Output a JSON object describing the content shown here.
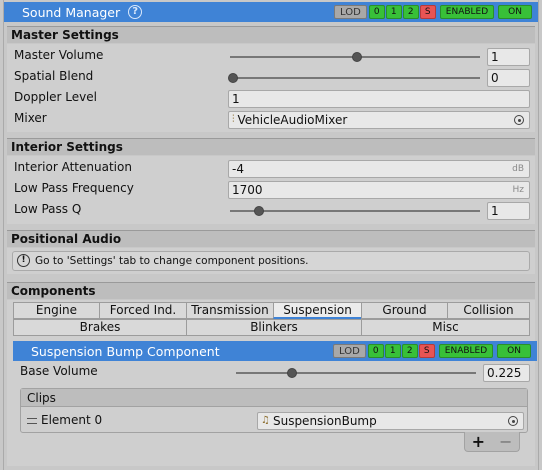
{
  "header": {
    "title": "Sound Manager",
    "badges": {
      "lod": "LOD",
      "levels": [
        "0",
        "1",
        "2",
        "S"
      ],
      "enabled": "ENABLED",
      "on": "ON"
    }
  },
  "master_settings": {
    "title": "Master Settings",
    "master_volume": {
      "label": "Master Volume",
      "value": "1",
      "slider": 0.55
    },
    "spatial_blend": {
      "label": "Spatial Blend",
      "value": "0",
      "slider": 0.0
    },
    "doppler_level": {
      "label": "Doppler Level",
      "value": "1"
    },
    "mixer": {
      "label": "Mixer",
      "value": "VehicleAudioMixer"
    }
  },
  "interior_settings": {
    "title": "Interior Settings",
    "attenuation": {
      "label": "Interior Attenuation",
      "value": "-4",
      "unit": "dB"
    },
    "low_pass_frequency": {
      "label": "Low Pass Frequency",
      "value": "1700",
      "unit": "Hz"
    },
    "low_pass_q": {
      "label": "Low Pass Q",
      "value": "1",
      "slider": 0.12
    }
  },
  "positional_audio": {
    "title": "Positional Audio",
    "help": "Go to 'Settings' tab to change component positions."
  },
  "components": {
    "title": "Components",
    "tabs_row1": [
      "Engine",
      "Forced Ind.",
      "Transmission",
      "Suspension",
      "Ground",
      "Collision"
    ],
    "tabs_row2": [
      "Brakes",
      "Blinkers",
      "Misc"
    ],
    "active_tab": "Suspension"
  },
  "suspension_component": {
    "title": "Suspension Bump Component",
    "badges": {
      "lod": "LOD",
      "levels": [
        "0",
        "1",
        "2",
        "S"
      ],
      "enabled": "ENABLED",
      "on": "ON"
    },
    "base_volume": {
      "label": "Base Volume",
      "value": "0.225",
      "slider": 0.23
    },
    "clips": {
      "title": "Clips",
      "elements": [
        {
          "label": "Element 0",
          "value": "SuspensionBump"
        }
      ],
      "add": "+",
      "remove": "−"
    }
  },
  "colors": {
    "accent": "#3f83d6",
    "badge_green": "#38c038",
    "badge_red": "#e85454"
  }
}
